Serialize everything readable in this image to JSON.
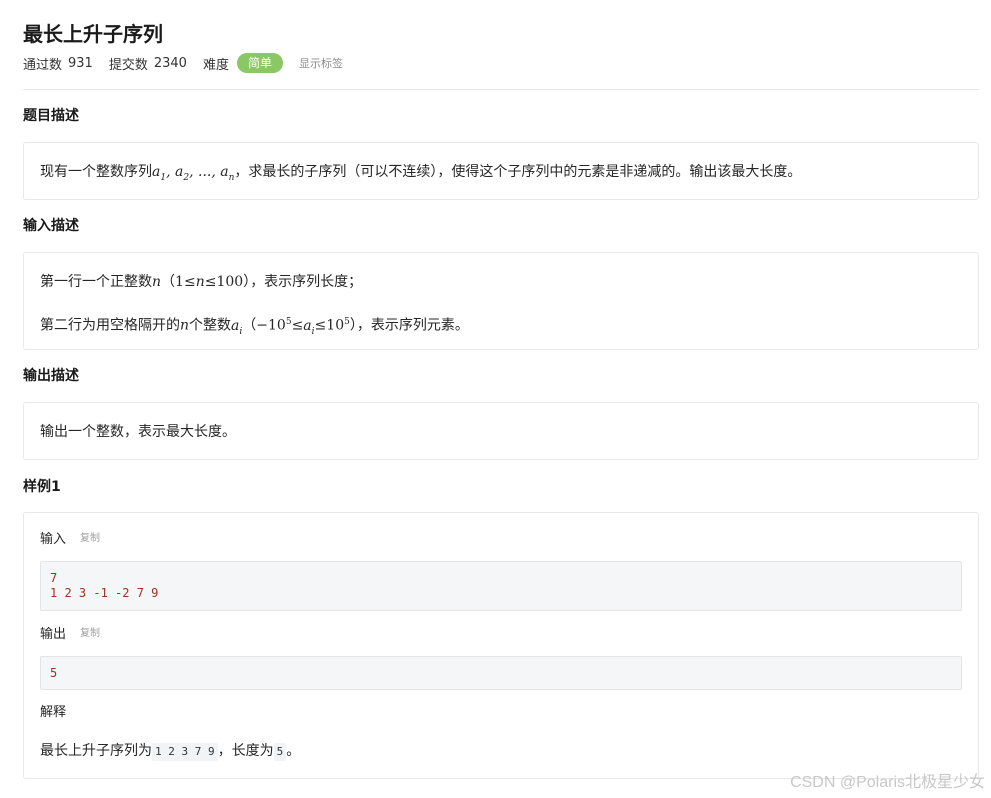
{
  "problem": {
    "title": "最长上升子序列",
    "stats": {
      "passed_label": "通过数",
      "passed_value": "931",
      "submitted_label": "提交数",
      "submitted_value": "2340",
      "difficulty_label": "难度",
      "difficulty_value": "简单",
      "difficulty_color": "#8ac765",
      "show_tags_label": "显示标签"
    }
  },
  "description": {
    "heading": "题目描述",
    "text_before": "现有一个整数序列",
    "math_seq": [
      "a",
      "1",
      "a",
      "2",
      "...",
      "a",
      "n"
    ],
    "text_after": "，求最长的子序列（可以不连续），使得这个子序列中的元素是非递减的。输出该最大长度。"
  },
  "input_desc": {
    "heading": "输入描述",
    "line1_before": "第一行一个正整数",
    "line1_var": "n",
    "line1_constraint_lo": "1",
    "line1_constraint_var": "n",
    "line1_constraint_hi": "100",
    "line1_after": "，表示序列长度；",
    "line2_before": "第二行为用空格隔开的",
    "line2_var": "n",
    "line2_mid": "个整数",
    "line2_var2": "a",
    "line2_var2_sub": "i",
    "line2_lo_base": "−10",
    "line2_lo_exp": "5",
    "line2_mid_var": "a",
    "line2_mid_var_sub": "i",
    "line2_hi_base": "10",
    "line2_hi_exp": "5",
    "line2_after": "，表示序列元素。"
  },
  "output_desc": {
    "heading": "输出描述",
    "text": "输出一个整数，表示最大长度。"
  },
  "sample": {
    "heading": "样例1",
    "input_label": "输入",
    "copy_label": "复制",
    "input_lines": [
      "7",
      "1 2 3 -1 -2 7 9"
    ],
    "output_label": "输出",
    "output_lines": [
      "5"
    ],
    "explain_label": "解释",
    "explain_before": "最长上升子序列为",
    "explain_code1": "1 2 3 7 9",
    "explain_mid": "，长度为",
    "explain_code2": "5",
    "explain_after": "。"
  },
  "watermark": "CSDN @Polaris北极星少女"
}
